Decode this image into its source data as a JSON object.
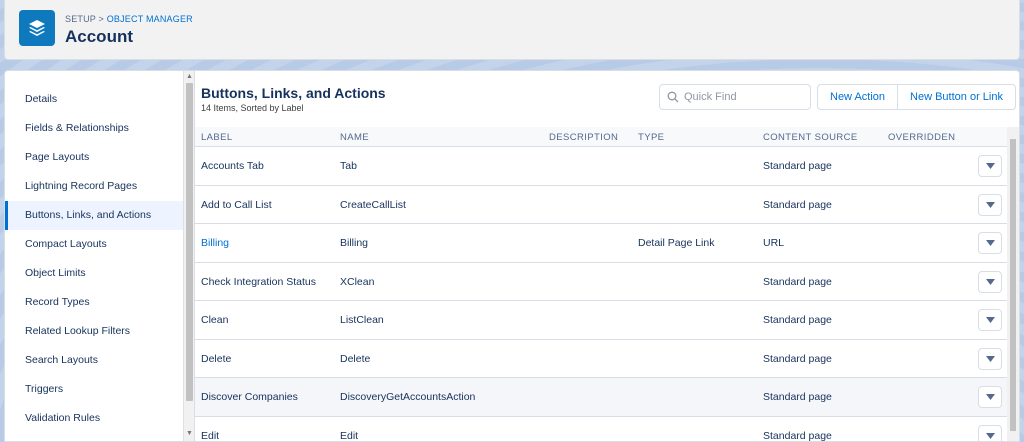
{
  "header": {
    "breadcrumb_setup": "SETUP",
    "breadcrumb_sep": " > ",
    "breadcrumb_object_manager": "OBJECT MANAGER",
    "title": "Account",
    "icon": "layers-icon"
  },
  "sidebar": {
    "items": [
      {
        "label": "Details"
      },
      {
        "label": "Fields & Relationships"
      },
      {
        "label": "Page Layouts"
      },
      {
        "label": "Lightning Record Pages"
      },
      {
        "label": "Buttons, Links, and Actions",
        "active": true
      },
      {
        "label": "Compact Layouts"
      },
      {
        "label": "Object Limits"
      },
      {
        "label": "Record Types"
      },
      {
        "label": "Related Lookup Filters"
      },
      {
        "label": "Search Layouts"
      },
      {
        "label": "Triggers"
      },
      {
        "label": "Validation Rules"
      }
    ]
  },
  "main": {
    "title": "Buttons, Links, and Actions",
    "subtitle": "14 Items, Sorted by Label",
    "quick_find_placeholder": "Quick Find",
    "new_action_label": "New Action",
    "new_button_label": "New Button or Link"
  },
  "table": {
    "columns": [
      "LABEL",
      "NAME",
      "DESCRIPTION",
      "TYPE",
      "CONTENT SOURCE",
      "OVERRIDDEN"
    ],
    "rows": [
      {
        "label": "Accounts Tab",
        "name": "Tab",
        "description": "",
        "type": "",
        "source": "Standard page"
      },
      {
        "label": "Add to Call List",
        "name": "CreateCallList",
        "description": "",
        "type": "",
        "source": "Standard page"
      },
      {
        "label": "Billing",
        "name": "Billing",
        "description": "",
        "type": "Detail Page Link",
        "source": "URL",
        "link": true
      },
      {
        "label": "Check Integration Status",
        "name": "XClean",
        "description": "",
        "type": "",
        "source": "Standard page"
      },
      {
        "label": "Clean",
        "name": "ListClean",
        "description": "",
        "type": "",
        "source": "Standard page"
      },
      {
        "label": "Delete",
        "name": "Delete",
        "description": "",
        "type": "",
        "source": "Standard page"
      },
      {
        "label": "Discover Companies",
        "name": "DiscoveryGetAccountsAction",
        "description": "",
        "type": "",
        "source": "Standard page",
        "hover": true
      },
      {
        "label": "Edit",
        "name": "Edit",
        "description": "",
        "type": "",
        "source": "Standard page"
      }
    ]
  },
  "colors": {
    "brand": "#0070d2",
    "icon_bg": "#0e7abd",
    "text": "#16325c",
    "border": "#d8dde6"
  }
}
